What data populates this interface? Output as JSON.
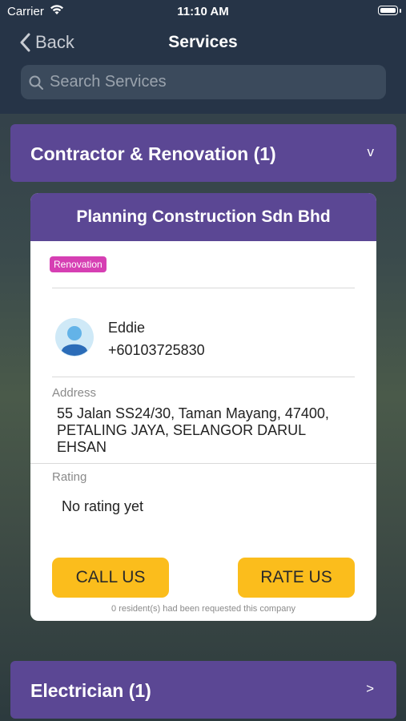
{
  "status_bar": {
    "carrier": "Carrier",
    "time": "11:10 AM"
  },
  "nav": {
    "back_label": "Back",
    "title": "Services"
  },
  "search": {
    "placeholder": "Search Services"
  },
  "categories": [
    {
      "label": "Contractor & Renovation (1)",
      "chevron": "v"
    },
    {
      "label": "Electrician (1)",
      "chevron": ">"
    }
  ],
  "card": {
    "company": "Planning Construction Sdn Bhd",
    "tag": "Renovation",
    "contact_name": "Eddie",
    "contact_phone": "+60103725830",
    "address_label": "Address",
    "address_lines": [
      "55 Jalan SS24/30, Taman Mayang, 47400,",
      "PETALING JAYA, SELANGOR DARUL",
      "EHSAN"
    ],
    "rating_label": "Rating",
    "rating_value": "No rating yet",
    "call_label": "CALL US",
    "rate_label": "RATE US",
    "footnote": "0 resident(s) had been requested this company"
  },
  "colors": {
    "header": "#263447",
    "category": "#5b4794",
    "button": "#fbbd1c",
    "tag": "#d63fb3"
  }
}
